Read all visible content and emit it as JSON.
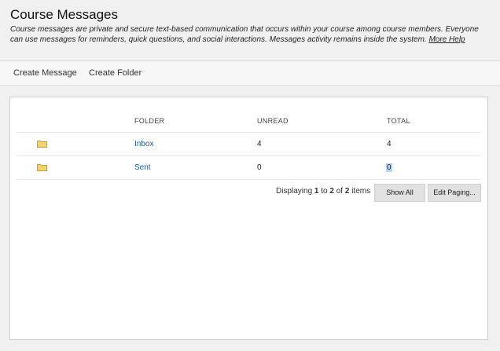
{
  "header": {
    "title": "Course Messages",
    "description": "Course messages are private and secure text-based communication that occurs within your course among course members. Everyone can use messages for reminders, quick questions, and social interactions. Messages activity remains inside the system.",
    "help_link": "More Help"
  },
  "actions": {
    "create_message": "Create Message",
    "create_folder": "Create Folder"
  },
  "table": {
    "columns": {
      "folder": "FOLDER",
      "unread": "UNREAD",
      "total": "TOTAL"
    },
    "rows": [
      {
        "icon": "folder-icon",
        "folder": "Inbox",
        "unread": "4",
        "total": "4"
      },
      {
        "icon": "folder-icon",
        "folder": "Sent",
        "unread": "0",
        "total": "0"
      }
    ]
  },
  "paging": {
    "prefix": "Displaying",
    "from": "1",
    "to_word": "to",
    "to": "2",
    "of_word": "of",
    "total": "2",
    "suffix": "items",
    "show_all": "Show All",
    "edit_paging": "Edit Paging..."
  },
  "colors": {
    "link": "#1a5fa8",
    "folder_icon": "#f3d36b",
    "button_bg": "#e1e1e1",
    "selection": "#b7d4f5"
  }
}
